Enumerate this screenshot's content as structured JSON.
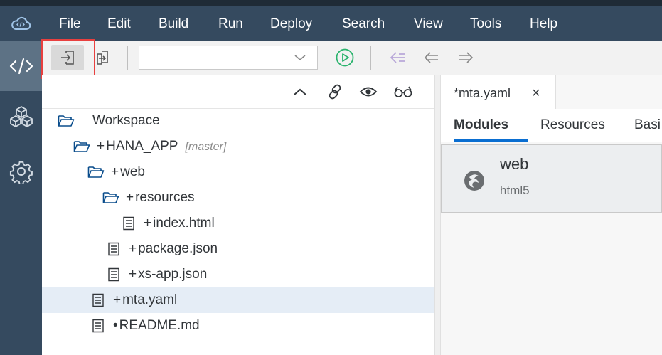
{
  "menubar": {
    "items": [
      {
        "label": "File"
      },
      {
        "label": "Edit"
      },
      {
        "label": "Build"
      },
      {
        "label": "Run"
      },
      {
        "label": "Deploy"
      },
      {
        "label": "Search"
      },
      {
        "label": "View"
      },
      {
        "label": "Tools"
      },
      {
        "label": "Help"
      }
    ]
  },
  "sidebar": {
    "items": [
      {
        "icon": "code-icon",
        "active": true
      },
      {
        "icon": "cubes-icon",
        "active": false
      },
      {
        "icon": "gear-icon",
        "active": false
      }
    ]
  },
  "toolbar": {
    "run_config_value": "",
    "icons": [
      "import-icon",
      "export-icon",
      "chevron-down-icon",
      "run-icon",
      "back-to-last-edit-icon",
      "navigate-back-icon",
      "navigate-forward-icon"
    ]
  },
  "explorer": {
    "tools": [
      "collapse-all-icon",
      "link-with-editor-icon",
      "show-hidden-files-icon",
      "preview-glasses-icon"
    ],
    "tree": [
      {
        "type": "folder",
        "prefix": "",
        "label": "Workspace",
        "branch": "",
        "selected": false
      },
      {
        "type": "folder",
        "prefix": "+",
        "label": "HANA_APP",
        "branch": "[master]",
        "selected": false
      },
      {
        "type": "folder",
        "prefix": "+",
        "label": "web",
        "branch": "",
        "selected": false
      },
      {
        "type": "folder",
        "prefix": "+",
        "label": "resources",
        "branch": "",
        "selected": false
      },
      {
        "type": "file",
        "prefix": "+",
        "label": "index.html",
        "branch": "",
        "selected": false
      },
      {
        "type": "file",
        "prefix": "+",
        "label": "package.json",
        "branch": "",
        "selected": false
      },
      {
        "type": "file",
        "prefix": "+",
        "label": "xs-app.json",
        "branch": "",
        "selected": false
      },
      {
        "type": "file",
        "prefix": "+",
        "label": "mta.yaml",
        "branch": "",
        "selected": true
      },
      {
        "type": "file",
        "prefix": "•",
        "label": "README.md",
        "branch": "",
        "selected": false
      }
    ]
  },
  "editor": {
    "tab": {
      "label": "*mta.yaml",
      "close": "×"
    },
    "subtabs": [
      {
        "label": "Modules",
        "active": true
      },
      {
        "label": "Resources",
        "active": false
      },
      {
        "label": "Basi",
        "active": false
      }
    ],
    "module": {
      "name": "web",
      "type": "html5"
    }
  },
  "colors": {
    "menubar": "#354a5f",
    "sidebar_active": "#5d7285",
    "accent": "#0a6ed1",
    "run_green": "#2ab36d",
    "highlight_red": "#e8403f",
    "folder_blue": "#0a4d8c"
  }
}
